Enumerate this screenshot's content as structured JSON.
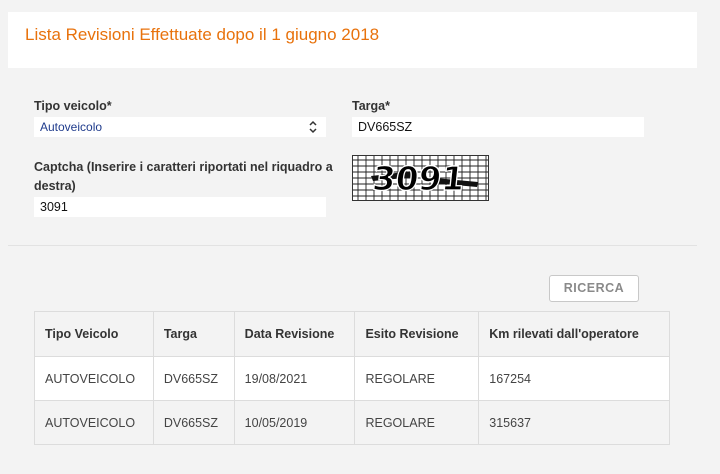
{
  "header": {
    "title": "Lista Revisioni Effettuate dopo il 1 giugno 2018"
  },
  "form": {
    "tipo_veicolo_label": "Tipo veicolo*",
    "tipo_veicolo_value": "Autoveicolo",
    "targa_label": "Targa*",
    "targa_value": "DV665SZ",
    "captcha_label": "Captcha (Inserire i caratteri riportati nel riquadro a destra)",
    "captcha_value": "3091",
    "captcha_image_text": "3091"
  },
  "actions": {
    "search_label": "RICERCA"
  },
  "table": {
    "headers": [
      "Tipo Veicolo",
      "Targa",
      "Data Revisione",
      "Esito Revisione",
      "Km rilevati dall'operatore"
    ],
    "rows": [
      [
        "AUTOVEICOLO",
        "DV665SZ",
        "19/08/2021",
        "REGOLARE",
        "167254"
      ],
      [
        "AUTOVEICOLO",
        "DV665SZ",
        "10/05/2019",
        "REGOLARE",
        "315637"
      ]
    ]
  },
  "colors": {
    "title_accent": "#e8720c",
    "select_text": "#1f3b8c",
    "background": "#f3f3f3",
    "card": "#ffffff"
  },
  "icons": {
    "select_arrows": "chevron-up-down-icon",
    "captcha": "captcha-image"
  }
}
